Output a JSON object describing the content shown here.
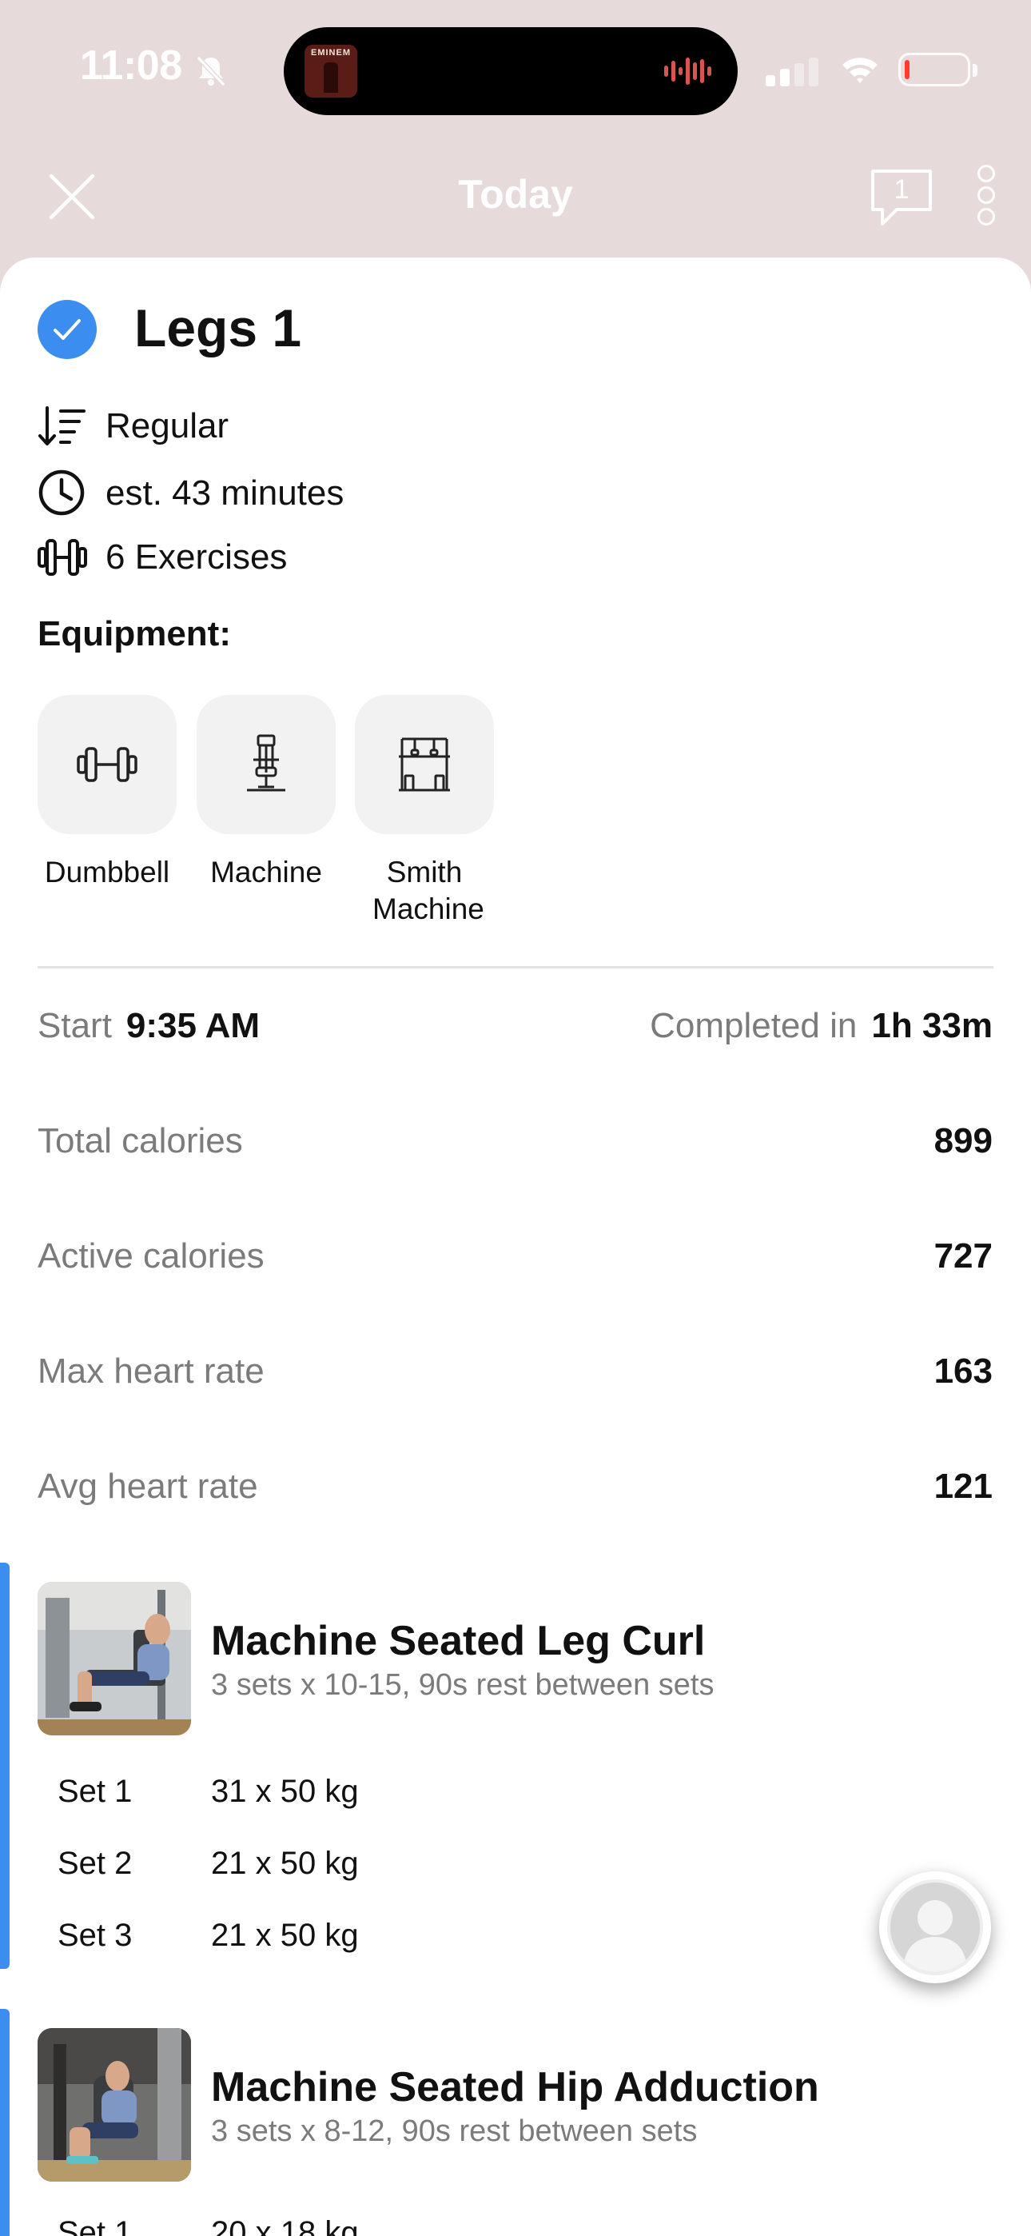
{
  "status_bar": {
    "time": "11:08",
    "album_art_text": "EMINEM",
    "battery_level": 0.08,
    "colors": {
      "battery_low": "#ff3b30"
    }
  },
  "nav": {
    "title": "Today",
    "comment_count": "1",
    "close_icon": "close-icon",
    "more_icon": "more-vertical-icon"
  },
  "workout": {
    "title": "Legs 1",
    "completed": true,
    "meta": [
      {
        "icon": "sort-icon",
        "text": "Regular"
      },
      {
        "icon": "clock-icon",
        "text": "est. 43 minutes"
      },
      {
        "icon": "dumbbell-icon",
        "text": "6 Exercises"
      }
    ],
    "equipment_heading": "Equipment:",
    "equipment": [
      {
        "icon": "dumbbell-icon",
        "label": "Dumbbell"
      },
      {
        "icon": "machine-icon",
        "label": "Machine"
      },
      {
        "icon": "smith-machine-icon",
        "label": "Smith Machine"
      }
    ]
  },
  "stats": {
    "start_label": "Start",
    "start_value": "9:35 AM",
    "completed_label": "Completed in",
    "completed_value": "1h 33m",
    "rows": [
      {
        "label": "Total calories",
        "value": "899"
      },
      {
        "label": "Active calories",
        "value": "727"
      },
      {
        "label": "Max heart rate",
        "value": "163"
      },
      {
        "label": "Avg heart rate",
        "value": "121"
      }
    ]
  },
  "exercises": [
    {
      "name": "Machine Seated Leg Curl",
      "desc": "3 sets x 10-15, 90s rest between sets",
      "sets": [
        {
          "label": "Set 1",
          "value": "31 x 50 kg"
        },
        {
          "label": "Set 2",
          "value": "21 x 50 kg"
        },
        {
          "label": "Set 3",
          "value": "21 x 50 kg"
        }
      ]
    },
    {
      "name": "Machine Seated Hip Adduction",
      "desc": "3 sets x 8-12, 90s rest between sets",
      "sets": [
        {
          "label": "Set 1",
          "value": "20 x 18 kg"
        }
      ]
    }
  ],
  "colors": {
    "accent": "#3b8ef0",
    "header_bg": "#e7dadb",
    "muted_text": "#7b7b7b"
  }
}
